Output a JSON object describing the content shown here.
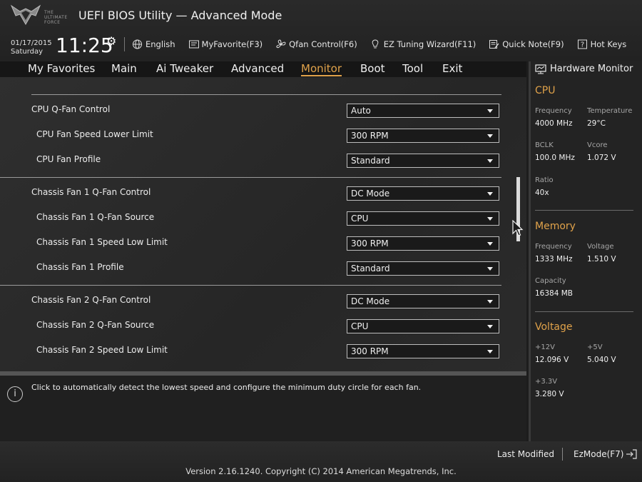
{
  "header": {
    "logo_text_lines": [
      "THE",
      "ULTIMATE",
      "FORCE"
    ],
    "title": "UEFI BIOS Utility — Advanced Mode",
    "date": "01/17/2015",
    "day": "Saturday",
    "time": "11:25",
    "toolbar": [
      {
        "label": "English",
        "icon": "globe-icon"
      },
      {
        "label": "MyFavorite(F3)",
        "icon": "favorite-icon"
      },
      {
        "label": "Qfan Control(F6)",
        "icon": "fan-icon"
      },
      {
        "label": "EZ Tuning Wizard(F11)",
        "icon": "lightbulb-icon"
      },
      {
        "label": "Quick Note(F9)",
        "icon": "note-icon"
      },
      {
        "label": "Hot Keys",
        "icon": "help-icon"
      }
    ]
  },
  "menu": [
    "My Favorites",
    "Main",
    "Ai Tweaker",
    "Advanced",
    "Monitor",
    "Boot",
    "Tool",
    "Exit"
  ],
  "active_menu": "Monitor",
  "accent_color": "#e0a24a",
  "settings": [
    {
      "label": "CPU Q-Fan Control",
      "value": "Auto",
      "indent": false
    },
    {
      "label": "CPU Fan Speed Lower Limit",
      "value": "300 RPM",
      "indent": true
    },
    {
      "label": "CPU Fan Profile",
      "value": "Standard",
      "indent": true
    },
    {
      "label": "Chassis Fan 1 Q-Fan Control",
      "value": "DC Mode",
      "indent": false
    },
    {
      "label": "Chassis Fan 1 Q-Fan Source",
      "value": "CPU",
      "indent": true
    },
    {
      "label": "Chassis Fan 1 Speed Low Limit",
      "value": "300 RPM",
      "indent": true
    },
    {
      "label": "Chassis Fan 1 Profile",
      "value": "Standard",
      "indent": true
    },
    {
      "label": "Chassis Fan 2 Q-Fan Control",
      "value": "DC Mode",
      "indent": false
    },
    {
      "label": "Chassis Fan 2 Q-Fan Source",
      "value": "CPU",
      "indent": true
    },
    {
      "label": "Chassis Fan 2 Speed Low Limit",
      "value": "300 RPM",
      "indent": true
    }
  ],
  "help_text": "Click to automatically detect the lowest speed and configure the minimum duty circle for each fan.",
  "hardware_monitor": {
    "title": "Hardware Monitor",
    "cpu": {
      "heading": "CPU",
      "frequency_label": "Frequency",
      "frequency": "4000 MHz",
      "temperature_label": "Temperature",
      "temperature": "29°C",
      "bclk_label": "BCLK",
      "bclk": "100.0 MHz",
      "vcore_label": "Vcore",
      "vcore": "1.072 V",
      "ratio_label": "Ratio",
      "ratio": "40x"
    },
    "memory": {
      "heading": "Memory",
      "frequency_label": "Frequency",
      "frequency": "1333 MHz",
      "voltage_label": "Voltage",
      "voltage": "1.510 V",
      "capacity_label": "Capacity",
      "capacity": "16384 MB"
    },
    "voltage": {
      "heading": "Voltage",
      "v12_label": "+12V",
      "v12": "12.096 V",
      "v5_label": "+5V",
      "v5": "5.040 V",
      "v33_label": "+3.3V",
      "v33": "3.280 V"
    }
  },
  "footer": {
    "last_modified": "Last Modified",
    "ezmode": "EzMode(F7)",
    "copyright": "Version 2.16.1240. Copyright (C) 2014 American Megatrends, Inc."
  }
}
